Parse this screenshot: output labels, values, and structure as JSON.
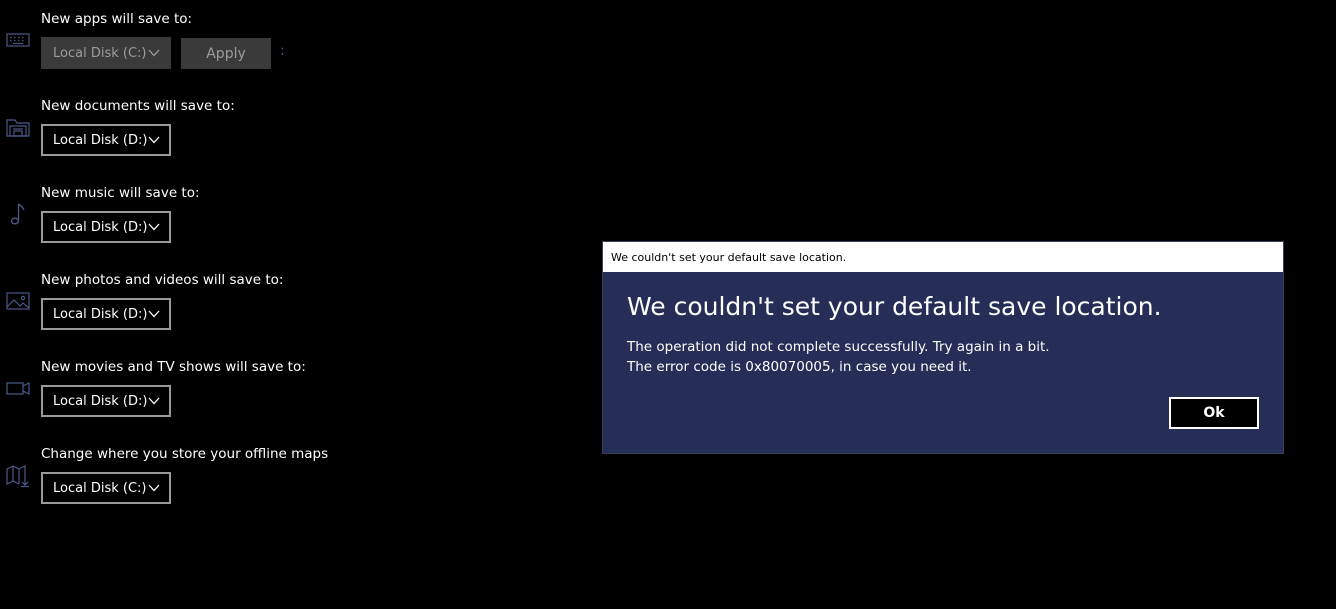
{
  "settings": [
    {
      "label": "New apps will save to:",
      "value": "Local Disk (C:)",
      "icon": "keyboard-icon",
      "disabled": true
    },
    {
      "label": "New documents will save to:",
      "value": "Local Disk (D:)",
      "icon": "documents-folder-icon",
      "disabled": false
    },
    {
      "label": "New music will save to:",
      "value": "Local Disk (D:)",
      "icon": "music-note-icon",
      "disabled": false
    },
    {
      "label": "New photos and videos will save to:",
      "value": "Local Disk (D:)",
      "icon": "photo-icon",
      "disabled": false
    },
    {
      "label": "New movies and TV shows will save to:",
      "value": "Local Disk (D:)",
      "icon": "video-camera-icon",
      "disabled": false
    },
    {
      "label": "Change where you store your offline maps",
      "value": "Local Disk (C:)",
      "icon": "map-download-icon",
      "disabled": false
    }
  ],
  "apply_label": "Apply",
  "more_glyph": ":",
  "dialog": {
    "title": "We couldn't set your default save location.",
    "heading": "We couldn't set your default save location.",
    "line1": "The operation did not complete successfully. Try again in a bit.",
    "line2": "The error code is 0x80070005, in case you need it.",
    "ok_label": "Ok"
  },
  "colors": {
    "background": "#000000",
    "dialog_bg": "#262d56",
    "icon": "#4a5a8a",
    "dropdown_border": "#9a9a9a",
    "disabled_bg": "#3a3a3a"
  }
}
